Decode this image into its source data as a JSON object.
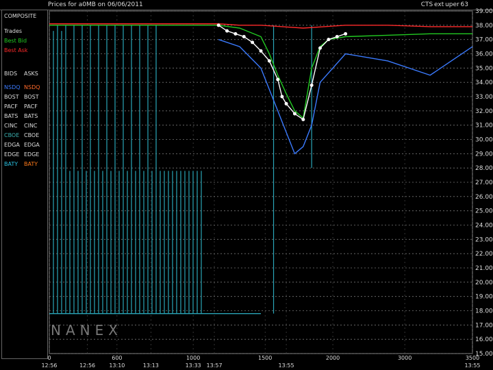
{
  "header": {
    "left_title": "Prices for a0MB on 06/06/2011",
    "right_title": "CTS ext uper 63"
  },
  "legend": {
    "title": "COMPOSITE",
    "trades_label": "Trades",
    "best_bid_label": "Best Bid",
    "best_ask_label": "Best Ask",
    "bids_header": "BIDS",
    "asks_header": "ASKS",
    "rows": [
      {
        "bid": "NSDQ",
        "ask": "NSDQ",
        "bid_color": "#3b7bff",
        "ask_color": "#ff6a2a"
      },
      {
        "bid": "BOST",
        "ask": "BOST",
        "bid_color": "#dddddd",
        "ask_color": "#dddddd"
      },
      {
        "bid": "PACF",
        "ask": "PACF",
        "bid_color": "#dddddd",
        "ask_color": "#dddddd"
      },
      {
        "bid": "BATS",
        "ask": "BATS",
        "bid_color": "#dddddd",
        "ask_color": "#dddddd"
      },
      {
        "bid": "CINC",
        "ask": "CINC",
        "bid_color": "#dddddd",
        "ask_color": "#dddddd"
      },
      {
        "bid": "CBOE",
        "ask": "CBOE",
        "bid_color": "#3bb0b0",
        "ask_color": "#dddddd"
      },
      {
        "bid": "EDGA",
        "ask": "EDGA",
        "bid_color": "#dddddd",
        "ask_color": "#dddddd"
      },
      {
        "bid": "EDGE",
        "ask": "EDGE",
        "bid_color": "#dddddd",
        "ask_color": "#dddddd"
      },
      {
        "bid": "BATY",
        "ask": "BATY",
        "bid_color": "#2ac0e0",
        "ask_color": "#ff7a1a"
      }
    ]
  },
  "watermark": "NANEX",
  "chart_data": {
    "type": "line",
    "ylim": [
      15.0,
      39.0
    ],
    "y_ticks": [
      "39.00",
      "38.00",
      "37.00",
      "36.00",
      "35.00",
      "34.00",
      "33.00",
      "32.00",
      "31.00",
      "30.00",
      "29.00",
      "28.00",
      "27.00",
      "26.00",
      "25.00",
      "24.00",
      "23.00",
      "22.00",
      "21.00",
      "20.00",
      "19.00",
      "18.00",
      "17.00",
      "16.00",
      "15.00"
    ],
    "x_ticks": [
      {
        "top": "0",
        "bottom": "12:56"
      },
      {
        "top": "",
        "bottom": "12:56"
      },
      {
        "top": "600",
        "bottom": "13:10"
      },
      {
        "top": "",
        "bottom": "13:13"
      },
      {
        "top": "1000",
        "bottom": "13:33"
      },
      {
        "top": "",
        "bottom": "13:57"
      },
      {
        "top": "1500",
        "bottom": ""
      },
      {
        "top": "",
        "bottom": "13:55"
      },
      {
        "top": "2000",
        "bottom": ""
      },
      {
        "top": "3000",
        "bottom": ""
      },
      {
        "top": "3500",
        "bottom": "13:55"
      }
    ],
    "x_tick_positions": [
      0.0,
      0.09,
      0.16,
      0.24,
      0.34,
      0.39,
      0.51,
      0.56,
      0.67,
      0.84,
      1.0
    ],
    "grid": true,
    "series": [
      {
        "name": "Best Bid",
        "color": "#22cc22",
        "x": [
          0.0,
          0.1,
          0.2,
          0.3,
          0.4,
          0.45,
          0.5,
          0.52,
          0.54,
          0.56,
          0.58,
          0.6,
          0.62,
          0.64,
          0.66,
          0.7,
          0.8,
          0.9,
          1.0
        ],
        "y": [
          38.0,
          38.0,
          38.0,
          38.0,
          38.0,
          37.8,
          37.2,
          36.0,
          34.5,
          33.2,
          32.0,
          31.5,
          35.0,
          36.5,
          37.0,
          37.2,
          37.3,
          37.4,
          37.4
        ]
      },
      {
        "name": "Best Ask",
        "color": "#ff2a2a",
        "x": [
          0.0,
          0.1,
          0.2,
          0.3,
          0.4,
          0.45,
          0.5,
          0.55,
          0.6,
          0.65,
          0.7,
          0.8,
          0.9,
          1.0
        ],
        "y": [
          38.1,
          38.1,
          38.1,
          38.1,
          38.1,
          38.0,
          38.0,
          37.9,
          37.8,
          37.9,
          38.0,
          38.0,
          37.9,
          37.9
        ]
      },
      {
        "name": "Trades",
        "color": "#ffffff",
        "x": [
          0.4,
          0.42,
          0.44,
          0.46,
          0.48,
          0.5,
          0.52,
          0.54,
          0.55,
          0.56,
          0.58,
          0.6,
          0.62,
          0.64,
          0.66,
          0.68,
          0.7
        ],
        "y": [
          38.0,
          37.6,
          37.4,
          37.2,
          36.8,
          36.2,
          35.5,
          34.2,
          33.0,
          32.5,
          31.8,
          31.4,
          33.8,
          36.4,
          37.0,
          37.2,
          37.4
        ]
      },
      {
        "name": "NSDQ",
        "color": "#3b7bff",
        "x": [
          0.4,
          0.45,
          0.5,
          0.52,
          0.54,
          0.56,
          0.58,
          0.6,
          0.62,
          0.64,
          0.7,
          0.8,
          0.9,
          1.0
        ],
        "y": [
          37.0,
          36.5,
          35.0,
          33.5,
          32.0,
          30.5,
          29.0,
          29.5,
          31.0,
          34.0,
          36.0,
          35.5,
          34.5,
          36.5
        ]
      }
    ]
  }
}
